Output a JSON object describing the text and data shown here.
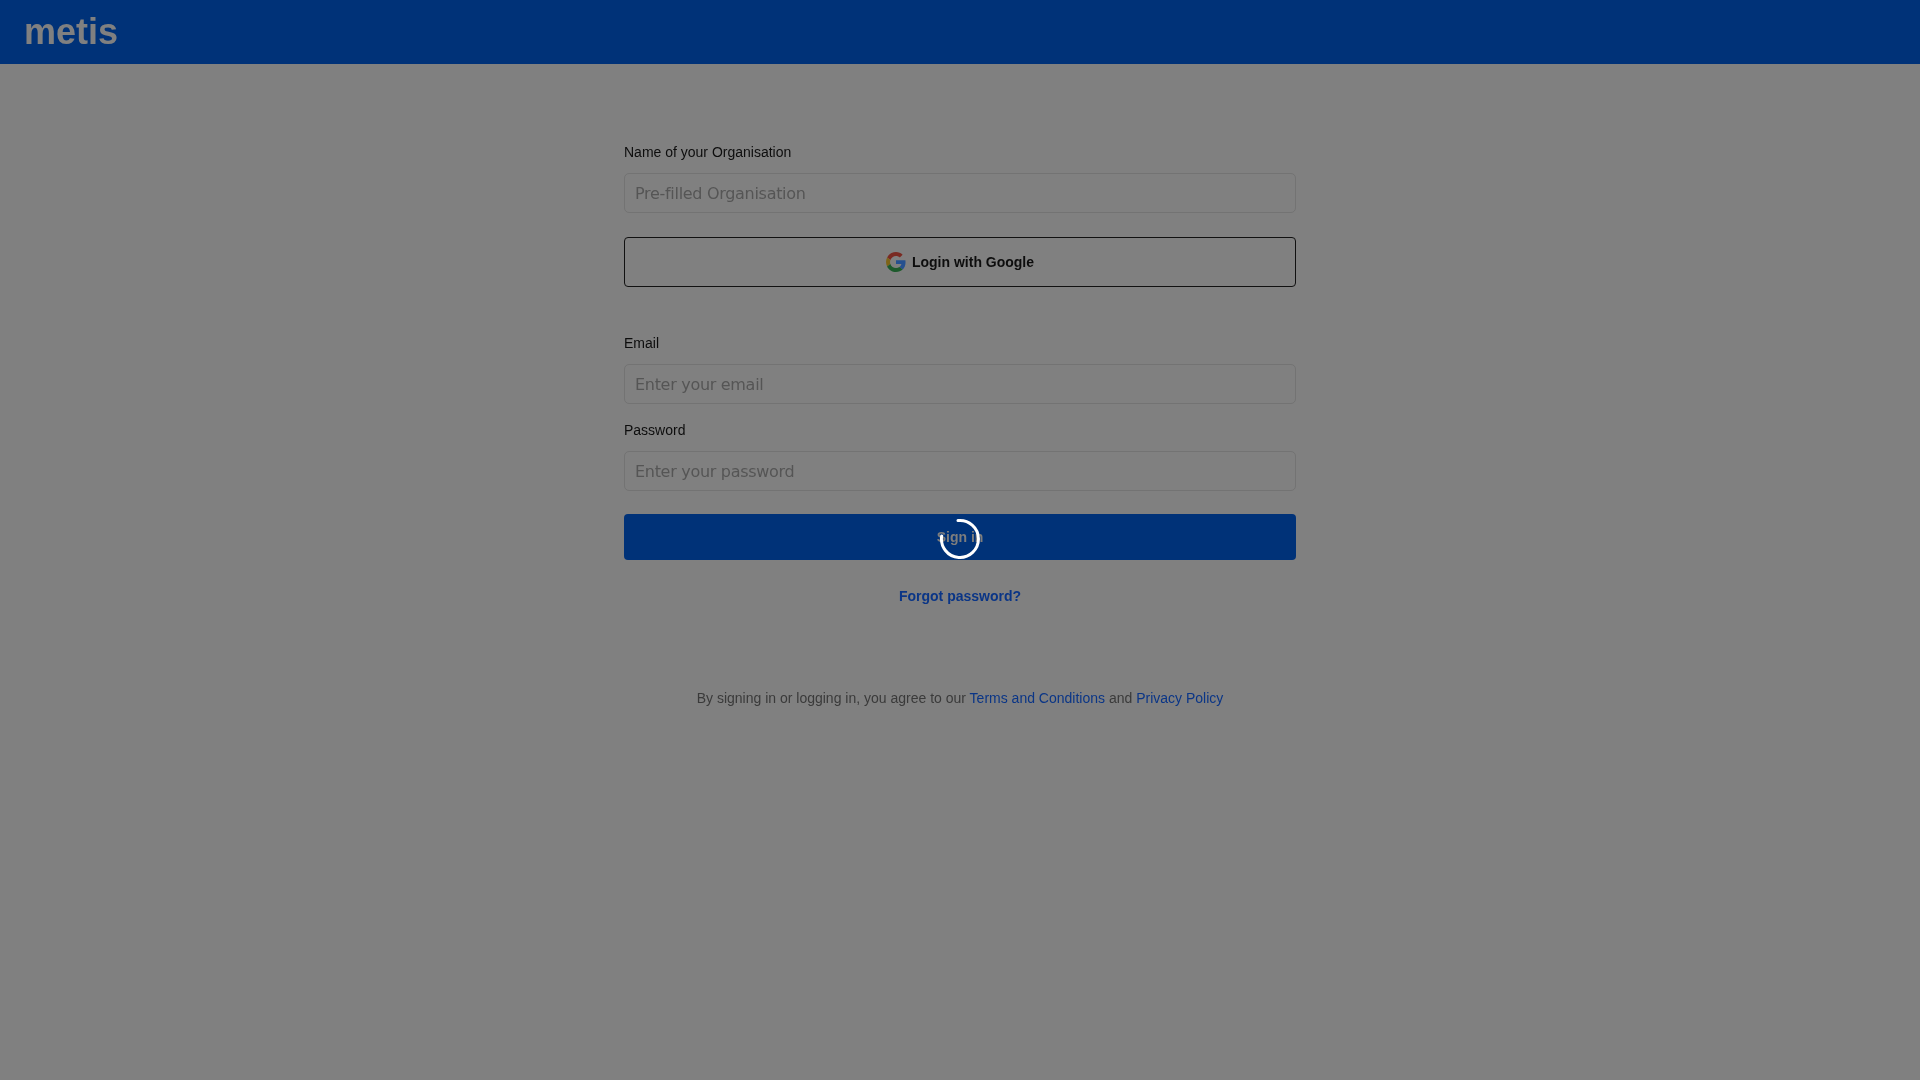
{
  "header": {
    "logo": "metis"
  },
  "form": {
    "fields_top": [
      {
        "label": "Name of your Organisation",
        "placeholder": "Pre-filled Organisation"
      }
    ],
    "google_button": {
      "label": "Login with Google"
    },
    "fields": [
      {
        "label": "Email",
        "placeholder": "Enter your email"
      },
      {
        "label": "Password",
        "placeholder": "Enter your password"
      }
    ],
    "sign_in_button": {
      "label": "Sign in",
      "loading": true
    },
    "forgot_password_link": "Forgot password?"
  },
  "footer": {
    "parts": [
      {
        "kind": "text",
        "text": "By signing in or logging in, you agree to our "
      },
      {
        "kind": "link",
        "text": "Terms and Conditions"
      },
      {
        "kind": "text",
        "text": " and "
      },
      {
        "kind": "link",
        "text": "Privacy Policy"
      }
    ]
  }
}
